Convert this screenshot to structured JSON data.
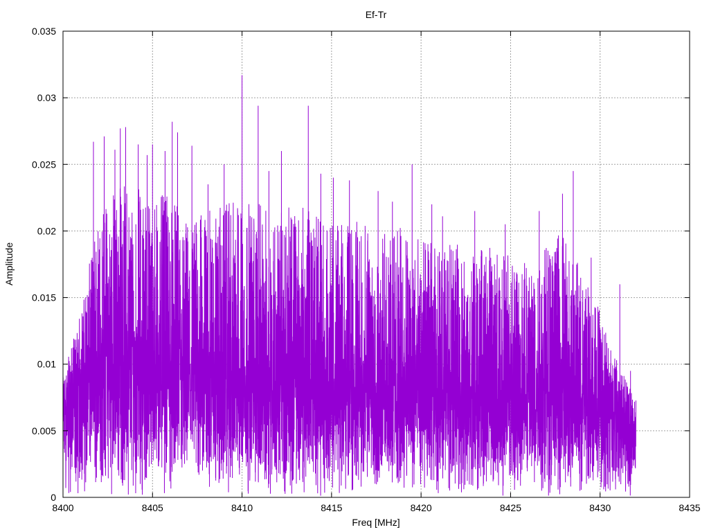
{
  "chart_data": {
    "type": "line",
    "title": "Ef-Tr",
    "xlabel": "Freq [MHz]",
    "ylabel": "Amplitude",
    "xlim": [
      8400,
      8435
    ],
    "ylim": [
      0,
      0.035
    ],
    "xticks": [
      8400,
      8405,
      8410,
      8415,
      8420,
      8425,
      8430,
      8435
    ],
    "xtick_labels": [
      "8400",
      "8405",
      "8410",
      "8415",
      "8420",
      "8425",
      "8430",
      "8435"
    ],
    "yticks": [
      0,
      0.005,
      0.01,
      0.015,
      0.02,
      0.025,
      0.03,
      0.035
    ],
    "ytick_labels": [
      "0",
      "0.005",
      "0.01",
      "0.015",
      "0.02",
      "0.025",
      "0.03",
      "0.035"
    ],
    "grid": true,
    "series": [
      {
        "color": "#9400d3",
        "x_range": [
          8400,
          8432
        ],
        "envelope": {
          "x": [
            8400,
            8401,
            8402,
            8403,
            8404,
            8405,
            8406,
            8407,
            8408,
            8409,
            8410,
            8411,
            8412,
            8413,
            8414,
            8415,
            8416,
            8417,
            8418,
            8419,
            8420,
            8421,
            8422,
            8423,
            8424,
            8425,
            8426,
            8427,
            8428,
            8429,
            8430,
            8431,
            8432
          ],
          "mean": [
            0.0065,
            0.0085,
            0.0105,
            0.0105,
            0.01,
            0.0098,
            0.0098,
            0.0095,
            0.0093,
            0.009,
            0.009,
            0.0088,
            0.0087,
            0.0088,
            0.0088,
            0.0086,
            0.0085,
            0.0084,
            0.0083,
            0.0083,
            0.0082,
            0.0082,
            0.0081,
            0.008,
            0.008,
            0.008,
            0.008,
            0.0079,
            0.0078,
            0.0077,
            0.0072,
            0.006,
            0.0048
          ],
          "peak": [
            0.009,
            0.014,
            0.0215,
            0.024,
            0.0235,
            0.023,
            0.0225,
            0.021,
            0.0215,
            0.022,
            0.0225,
            0.022,
            0.0215,
            0.022,
            0.0215,
            0.0205,
            0.021,
            0.0205,
            0.02,
            0.0205,
            0.0195,
            0.019,
            0.019,
            0.0185,
            0.019,
            0.0185,
            0.019,
            0.0195,
            0.02,
            0.017,
            0.0145,
            0.01,
            0.0075
          ]
        },
        "spikes": [
          {
            "x": 8401.7,
            "y": 0.0267
          },
          {
            "x": 8402.3,
            "y": 0.0271
          },
          {
            "x": 8402.9,
            "y": 0.0261
          },
          {
            "x": 8403.2,
            "y": 0.0277
          },
          {
            "x": 8403.5,
            "y": 0.0278
          },
          {
            "x": 8404.2,
            "y": 0.0265
          },
          {
            "x": 8404.7,
            "y": 0.0257
          },
          {
            "x": 8405.0,
            "y": 0.0265
          },
          {
            "x": 8405.7,
            "y": 0.026
          },
          {
            "x": 8406.1,
            "y": 0.0282
          },
          {
            "x": 8406.4,
            "y": 0.0274
          },
          {
            "x": 8407.2,
            "y": 0.0264
          },
          {
            "x": 8408.1,
            "y": 0.0235
          },
          {
            "x": 8409.0,
            "y": 0.025
          },
          {
            "x": 8410.0,
            "y": 0.0317
          },
          {
            "x": 8410.9,
            "y": 0.0294
          },
          {
            "x": 8411.5,
            "y": 0.0245
          },
          {
            "x": 8412.2,
            "y": 0.026
          },
          {
            "x": 8413.7,
            "y": 0.0294
          },
          {
            "x": 8414.4,
            "y": 0.0243
          },
          {
            "x": 8415.1,
            "y": 0.024
          },
          {
            "x": 8416.0,
            "y": 0.0238
          },
          {
            "x": 8417.6,
            "y": 0.023
          },
          {
            "x": 8418.4,
            "y": 0.0222
          },
          {
            "x": 8419.5,
            "y": 0.025
          },
          {
            "x": 8420.6,
            "y": 0.022
          },
          {
            "x": 8421.2,
            "y": 0.0211
          },
          {
            "x": 8423.0,
            "y": 0.0215
          },
          {
            "x": 8424.7,
            "y": 0.0205
          },
          {
            "x": 8426.6,
            "y": 0.0215
          },
          {
            "x": 8427.9,
            "y": 0.0228
          },
          {
            "x": 8428.5,
            "y": 0.0245
          },
          {
            "x": 8429.5,
            "y": 0.018
          },
          {
            "x": 8431.1,
            "y": 0.016
          },
          {
            "x": 8431.7,
            "y": 0.0095
          }
        ]
      }
    ]
  }
}
